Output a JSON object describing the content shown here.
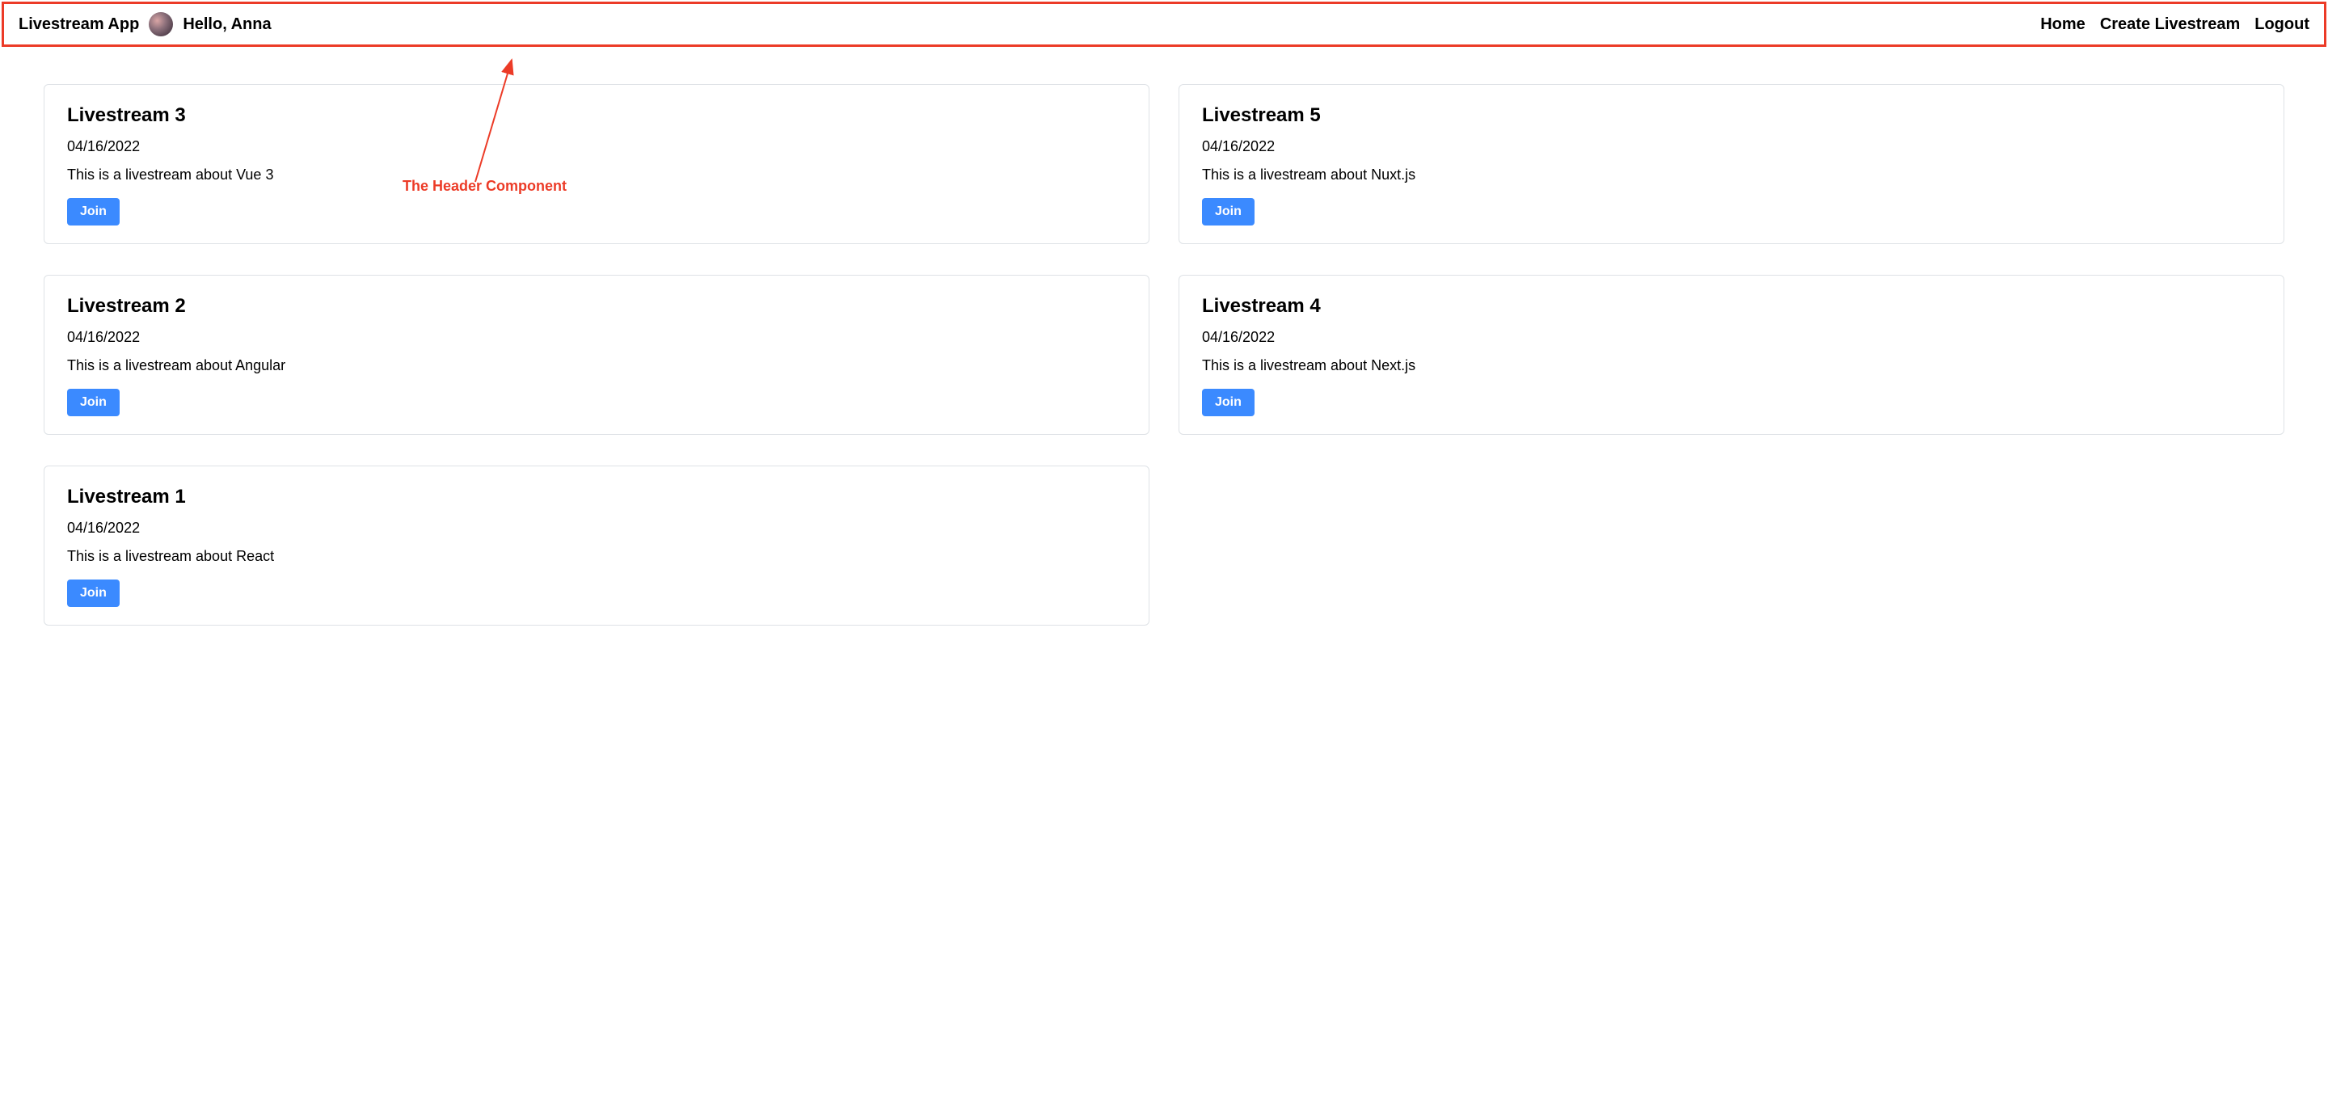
{
  "header": {
    "app_title": "Livestream App",
    "greeting": "Hello, Anna",
    "nav": {
      "home": "Home",
      "create": "Create Livestream",
      "logout": "Logout"
    }
  },
  "annotation": {
    "label": "The Header Component"
  },
  "buttons": {
    "join": "Join"
  },
  "livestreams": [
    {
      "title": "Livestream 3",
      "date": "04/16/2022",
      "description": "This is a livestream about Vue 3"
    },
    {
      "title": "Livestream 5",
      "date": "04/16/2022",
      "description": "This is a livestream about Nuxt.js"
    },
    {
      "title": "Livestream 2",
      "date": "04/16/2022",
      "description": "This is a livestream about Angular"
    },
    {
      "title": "Livestream 4",
      "date": "04/16/2022",
      "description": "This is a livestream about Next.js"
    },
    {
      "title": "Livestream 1",
      "date": "04/16/2022",
      "description": "This is a livestream about React"
    }
  ]
}
